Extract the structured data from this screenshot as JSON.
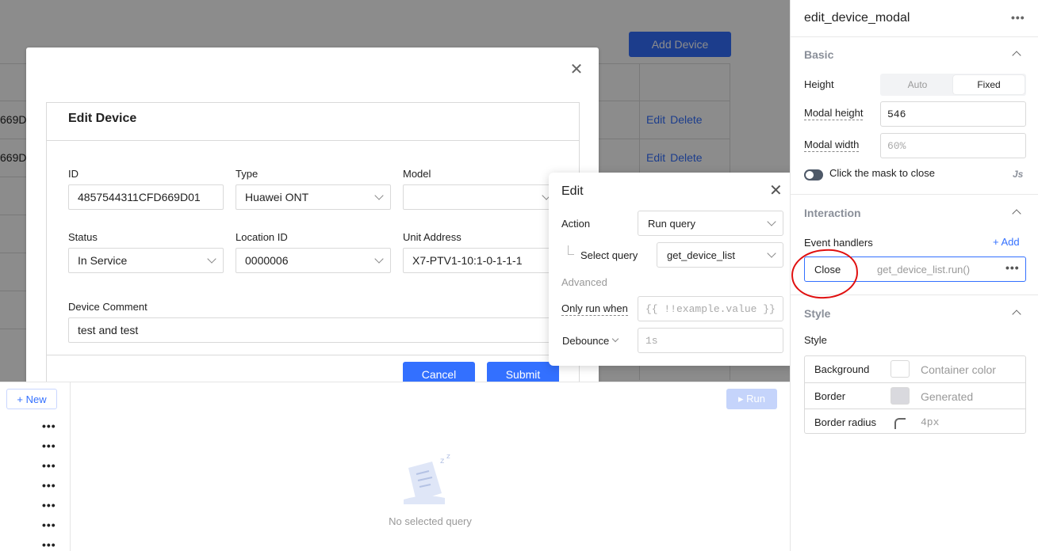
{
  "canvas": {
    "add_device_label": "Add Device",
    "bg_rows": [
      {
        "id_fragment": "669D",
        "edit": "Edit",
        "delete": "Delete"
      },
      {
        "id_fragment": "669D",
        "edit": "Edit",
        "delete": "Delete"
      }
    ]
  },
  "modal": {
    "title": "Edit Device",
    "close_icon": "close-icon",
    "fields": {
      "id_label": "ID",
      "id_value": "4857544311CFD669D01",
      "type_label": "Type",
      "type_value": "Huawei ONT",
      "model_label": "Model",
      "model_value": "",
      "status_label": "Status",
      "status_value": "In Service",
      "location_label": "Location ID",
      "location_value": "0000006",
      "unit_label": "Unit Address",
      "unit_value": "X7-PTV1-10:1-0-1-1-1",
      "comment_label": "Device Comment",
      "comment_value": "test and test"
    },
    "cancel_label": "Cancel",
    "submit_label": "Submit"
  },
  "query_panel": {
    "new_label": "+ New",
    "run_label": "▸ Run",
    "empty_text": "No selected query",
    "row_count": 7
  },
  "edit_popup": {
    "title": "Edit",
    "action_label": "Action",
    "action_value": "Run query",
    "select_query_label": "Select query",
    "select_query_value": "get_device_list",
    "advanced_label": "Advanced",
    "only_run_when_label": "Only run when",
    "only_run_when_placeholder": "{{ !!example.value }}",
    "debounce_label": "Debounce",
    "debounce_placeholder": "1s"
  },
  "inspector": {
    "title": "edit_device_modal",
    "basic": {
      "heading": "Basic",
      "height_label": "Height",
      "height_options": [
        "Auto",
        "Fixed"
      ],
      "height_selected": "Fixed",
      "modal_height_label": "Modal height",
      "modal_height_value": "546",
      "modal_width_label": "Modal width",
      "modal_width_placeholder": "60%",
      "mask_close_label": "Click the mask to close",
      "js_label": "Js"
    },
    "interaction": {
      "heading": "Interaction",
      "event_handlers_label": "Event handlers",
      "add_label": "+ Add",
      "handler_event": "Close",
      "handler_action": "get_device_list.run()"
    },
    "style": {
      "heading": "Style",
      "sub_label": "Style",
      "rows": [
        {
          "name": "Background",
          "value": "Container color"
        },
        {
          "name": "Border",
          "value": "Generated"
        },
        {
          "name": "Border radius",
          "value": "4px"
        }
      ]
    }
  },
  "annotation": {
    "color": "#e01010"
  },
  "colors": {
    "accent": "#3370ff",
    "mask": "rgba(0,0,0,0.45)"
  }
}
